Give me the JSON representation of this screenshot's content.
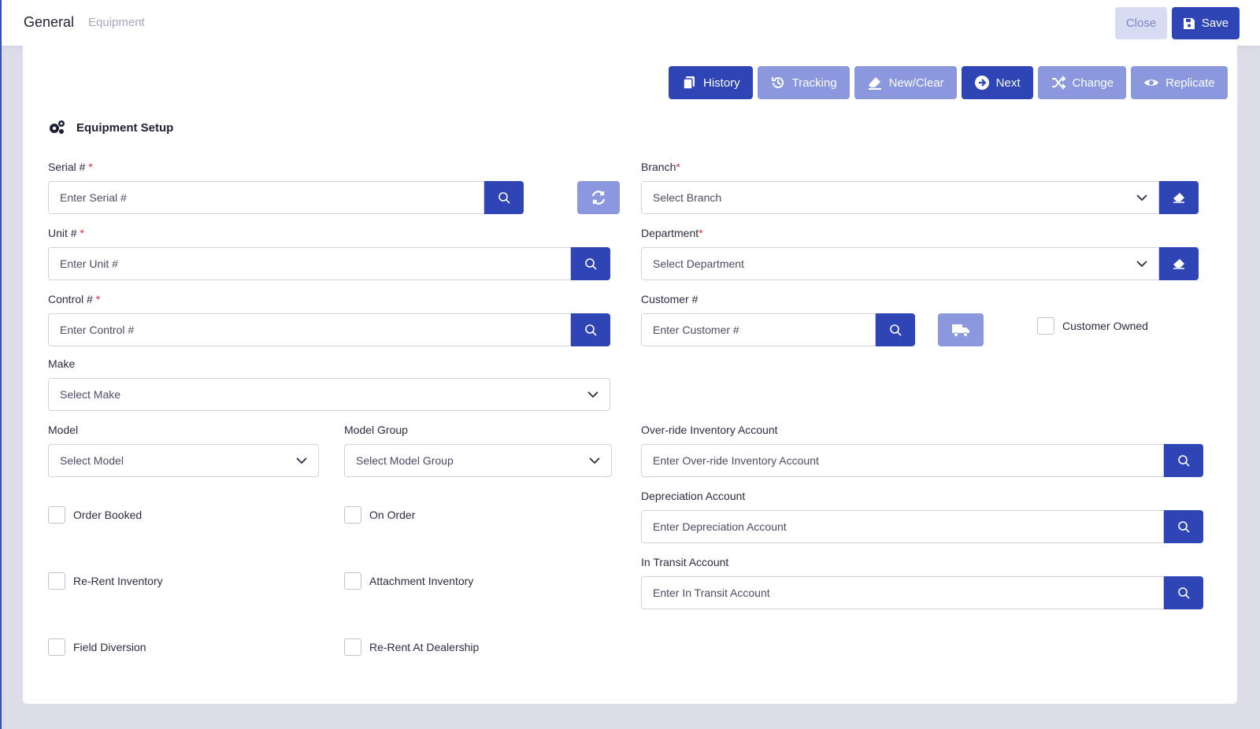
{
  "header": {
    "tab_general": "General",
    "tab_equipment": "Equipment",
    "close_label": "Close",
    "save_label": "Save"
  },
  "actions": [
    {
      "label": "History",
      "icon": "copy-icon",
      "style": "dark"
    },
    {
      "label": "Tracking",
      "icon": "history-icon",
      "style": "light"
    },
    {
      "label": "New/Clear",
      "icon": "eraser-icon",
      "style": "light"
    },
    {
      "label": "Next",
      "icon": "arrow-right-circle-icon",
      "style": "dark"
    },
    {
      "label": "Change",
      "icon": "shuffle-icon",
      "style": "light"
    },
    {
      "label": "Replicate",
      "icon": "eye-icon",
      "style": "light"
    }
  ],
  "section": {
    "title": "Equipment Setup",
    "icon": "gears-icon"
  },
  "fields": {
    "serial": {
      "label": "Serial #",
      "placeholder": "Enter Serial #"
    },
    "unit": {
      "label": "Unit #",
      "placeholder": "Enter Unit #"
    },
    "control": {
      "label": "Control #",
      "placeholder": "Enter Control #"
    },
    "make": {
      "label": "Make",
      "placeholder": "Select Make"
    },
    "model": {
      "label": "Model",
      "placeholder": "Select Model"
    },
    "model_group": {
      "label": "Model Group",
      "placeholder": "Select Model Group"
    },
    "branch": {
      "label": "Branch",
      "placeholder": "Select Branch"
    },
    "department": {
      "label": "Department",
      "placeholder": "Select Department"
    },
    "customer": {
      "label": "Customer #",
      "placeholder": "Enter Customer #"
    },
    "customer_owned": "Customer Owned",
    "override_inventory": {
      "label": "Over-ride Inventory Account",
      "placeholder": "Enter Over-ride Inventory Account"
    },
    "depreciation": {
      "label": "Depreciation Account",
      "placeholder": "Enter Depreciation Account"
    },
    "in_transit": {
      "label": "In Transit Account",
      "placeholder": "Enter In Transit Account"
    }
  },
  "checkboxes": {
    "order_booked": "Order Booked",
    "on_order": "On Order",
    "rerent_inventory": "Re-Rent Inventory",
    "attachment_inventory": "Attachment Inventory",
    "field_diversion": "Field Diversion",
    "rerent_dealership": "Re-Rent At Dealership"
  },
  "required_mark": "*",
  "colors": {
    "primary": "#2f45b5",
    "primary_light": "#8b98de",
    "required": "#e03131"
  }
}
